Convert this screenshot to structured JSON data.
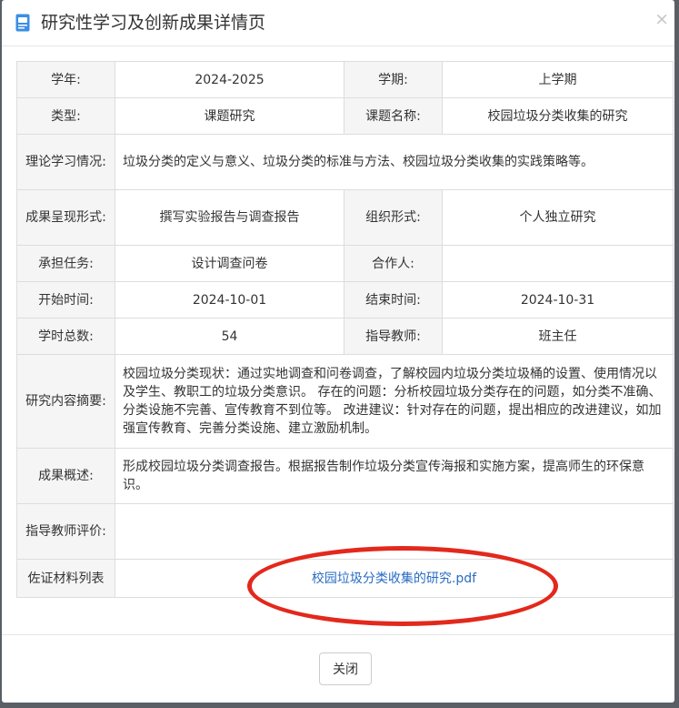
{
  "dialog": {
    "title": "研究性学习及创新成果详情页",
    "close_symbol": "×",
    "icon": "document-icon"
  },
  "fields": {
    "school_year_label": "学年:",
    "school_year": "2024-2025",
    "term_label": "学期:",
    "term": "上学期",
    "type_label": "类型:",
    "type": "课题研究",
    "topic_label": "课题名称:",
    "topic": "校园垃圾分类收集的研究",
    "theory_label": "理论学习情况:",
    "theory": "垃圾分类的定义与意义、垃圾分类的标准与方法、校园垃圾分类收集的实践策略等。",
    "result_form_label": "成果呈现形式:",
    "result_form": "撰写实验报告与调查报告",
    "organization_label": "组织形式:",
    "organization": "个人独立研究",
    "task_label": "承担任务:",
    "task": "设计调查问卷",
    "partner_label": "合作人:",
    "partner": "",
    "start_label": "开始时间:",
    "start": "2024-10-01",
    "end_label": "结束时间:",
    "end": "2024-10-31",
    "hours_label": "学时总数:",
    "hours": "54",
    "teacher_label": "指导教师:",
    "teacher": "班主任",
    "abstract_label": "研究内容摘要:",
    "abstract": "校园垃圾分类现状：通过实地调查和问卷调查，了解校园内垃圾分类垃圾桶的设置、使用情况以及学生、教职工的垃圾分类意识。 存在的问题：分析校园垃圾分类存在的问题，如分类不准确、分类设施不完善、宣传教育不到位等。 改进建议：针对存在的问题，提出相应的改进建议，如加强宣传教育、完善分类设施、建立激励机制。",
    "summary_label": "成果概述:",
    "summary": "形成校园垃圾分类调查报告。根据报告制作垃圾分类宣传海报和实施方案，提高师生的环保意识。",
    "teacher_comment_label": "指导教师评价:",
    "teacher_comment": "",
    "evidence_label": "佐证材料列表",
    "evidence_file": "校园垃圾分类收集的研究.pdf"
  },
  "footer": {
    "close_label": "关闭"
  },
  "colors": {
    "label_bg": "#f5f5f5",
    "border": "#dddddd",
    "link": "#2a6cc4",
    "annotation_oval": "#e3281c"
  }
}
